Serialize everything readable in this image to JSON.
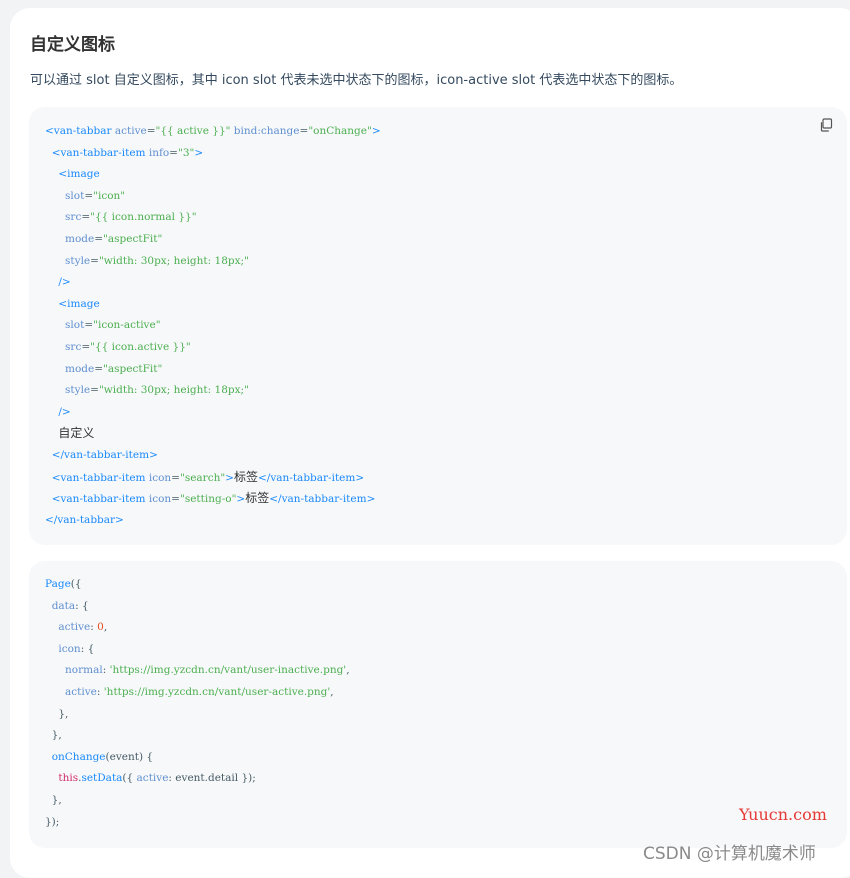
{
  "section": {
    "title": "自定义图标",
    "description": "可以通过 slot 自定义图标，其中 icon slot 代表未选中状态下的图标，icon-active slot 代表选中状态下的图标。"
  },
  "code_block_1": {
    "copy_icon": "copy-icon",
    "lines": [
      [
        {
          "t": "tag",
          "v": "<van-tabbar"
        },
        {
          "t": "attr",
          "v": " active"
        },
        {
          "t": "plain",
          "v": "="
        },
        {
          "t": "str",
          "v": "\"{{ active }}\""
        },
        {
          "t": "attr",
          "v": " bind:change"
        },
        {
          "t": "plain",
          "v": "="
        },
        {
          "t": "str",
          "v": "\"onChange\""
        },
        {
          "t": "tag",
          "v": ">"
        }
      ],
      [
        {
          "t": "plain",
          "v": "  "
        },
        {
          "t": "tag",
          "v": "<van-tabbar-item"
        },
        {
          "t": "attr",
          "v": " info"
        },
        {
          "t": "plain",
          "v": "="
        },
        {
          "t": "str",
          "v": "\"3\""
        },
        {
          "t": "tag",
          "v": ">"
        }
      ],
      [
        {
          "t": "plain",
          "v": "    "
        },
        {
          "t": "tag",
          "v": "<image"
        }
      ],
      [
        {
          "t": "plain",
          "v": "      "
        },
        {
          "t": "attr",
          "v": "slot"
        },
        {
          "t": "plain",
          "v": "="
        },
        {
          "t": "str",
          "v": "\"icon\""
        }
      ],
      [
        {
          "t": "plain",
          "v": "      "
        },
        {
          "t": "attr",
          "v": "src"
        },
        {
          "t": "plain",
          "v": "="
        },
        {
          "t": "str",
          "v": "\"{{ icon.normal }}\""
        }
      ],
      [
        {
          "t": "plain",
          "v": "      "
        },
        {
          "t": "attr",
          "v": "mode"
        },
        {
          "t": "plain",
          "v": "="
        },
        {
          "t": "str",
          "v": "\"aspectFit\""
        }
      ],
      [
        {
          "t": "plain",
          "v": "      "
        },
        {
          "t": "attr",
          "v": "style"
        },
        {
          "t": "plain",
          "v": "="
        },
        {
          "t": "str",
          "v": "\"width: 30px; height: 18px;\""
        }
      ],
      [
        {
          "t": "plain",
          "v": "    "
        },
        {
          "t": "tag",
          "v": "/>"
        }
      ],
      [
        {
          "t": "plain",
          "v": "    "
        },
        {
          "t": "tag",
          "v": "<image"
        }
      ],
      [
        {
          "t": "plain",
          "v": "      "
        },
        {
          "t": "attr",
          "v": "slot"
        },
        {
          "t": "plain",
          "v": "="
        },
        {
          "t": "str",
          "v": "\"icon-active\""
        }
      ],
      [
        {
          "t": "plain",
          "v": "      "
        },
        {
          "t": "attr",
          "v": "src"
        },
        {
          "t": "plain",
          "v": "="
        },
        {
          "t": "str",
          "v": "\"{{ icon.active }}\""
        }
      ],
      [
        {
          "t": "plain",
          "v": "      "
        },
        {
          "t": "attr",
          "v": "mode"
        },
        {
          "t": "plain",
          "v": "="
        },
        {
          "t": "str",
          "v": "\"aspectFit\""
        }
      ],
      [
        {
          "t": "plain",
          "v": "      "
        },
        {
          "t": "attr",
          "v": "style"
        },
        {
          "t": "plain",
          "v": "="
        },
        {
          "t": "str",
          "v": "\"width: 30px; height: 18px;\""
        }
      ],
      [
        {
          "t": "plain",
          "v": "    "
        },
        {
          "t": "tag",
          "v": "/>"
        }
      ],
      [
        {
          "t": "plain",
          "v": "    "
        },
        {
          "t": "txt",
          "v": "自定义"
        }
      ],
      [
        {
          "t": "plain",
          "v": "  "
        },
        {
          "t": "tag",
          "v": "</van-tabbar-item>"
        }
      ],
      [
        {
          "t": "plain",
          "v": "  "
        },
        {
          "t": "tag",
          "v": "<van-tabbar-item"
        },
        {
          "t": "attr",
          "v": " icon"
        },
        {
          "t": "plain",
          "v": "="
        },
        {
          "t": "str",
          "v": "\"search\""
        },
        {
          "t": "tag",
          "v": ">"
        },
        {
          "t": "txt",
          "v": "标签"
        },
        {
          "t": "tag",
          "v": "</van-tabbar-item>"
        }
      ],
      [
        {
          "t": "plain",
          "v": "  "
        },
        {
          "t": "tag",
          "v": "<van-tabbar-item"
        },
        {
          "t": "attr",
          "v": " icon"
        },
        {
          "t": "plain",
          "v": "="
        },
        {
          "t": "str",
          "v": "\"setting-o\""
        },
        {
          "t": "tag",
          "v": ">"
        },
        {
          "t": "txt",
          "v": "标签"
        },
        {
          "t": "tag",
          "v": "</van-tabbar-item>"
        }
      ],
      [
        {
          "t": "tag",
          "v": "</van-tabbar>"
        }
      ]
    ]
  },
  "code_block_2": {
    "lines": [
      [
        {
          "t": "fn",
          "v": "Page"
        },
        {
          "t": "plain",
          "v": "({"
        }
      ],
      [
        {
          "t": "plain",
          "v": "  "
        },
        {
          "t": "attr",
          "v": "data"
        },
        {
          "t": "plain",
          "v": ": {"
        }
      ],
      [
        {
          "t": "plain",
          "v": "    "
        },
        {
          "t": "attr",
          "v": "active"
        },
        {
          "t": "plain",
          "v": ": "
        },
        {
          "t": "num",
          "v": "0"
        },
        {
          "t": "plain",
          "v": ","
        }
      ],
      [
        {
          "t": "plain",
          "v": "    "
        },
        {
          "t": "attr",
          "v": "icon"
        },
        {
          "t": "plain",
          "v": ": {"
        }
      ],
      [
        {
          "t": "plain",
          "v": "      "
        },
        {
          "t": "attr",
          "v": "normal"
        },
        {
          "t": "plain",
          "v": ": "
        },
        {
          "t": "str",
          "v": "'https://img.yzcdn.cn/vant/user-inactive.png'"
        },
        {
          "t": "plain",
          "v": ","
        }
      ],
      [
        {
          "t": "plain",
          "v": "      "
        },
        {
          "t": "attr",
          "v": "active"
        },
        {
          "t": "plain",
          "v": ": "
        },
        {
          "t": "str",
          "v": "'https://img.yzcdn.cn/vant/user-active.png'"
        },
        {
          "t": "plain",
          "v": ","
        }
      ],
      [
        {
          "t": "plain",
          "v": "    },"
        }
      ],
      [
        {
          "t": "plain",
          "v": "  },"
        }
      ],
      [
        {
          "t": "plain",
          "v": "  "
        },
        {
          "t": "fn",
          "v": "onChange"
        },
        {
          "t": "plain",
          "v": "(event) {"
        }
      ],
      [
        {
          "t": "plain",
          "v": "    "
        },
        {
          "t": "kw",
          "v": "this"
        },
        {
          "t": "plain",
          "v": "."
        },
        {
          "t": "fn",
          "v": "setData"
        },
        {
          "t": "plain",
          "v": "({ "
        },
        {
          "t": "attr",
          "v": "active"
        },
        {
          "t": "plain",
          "v": ": event.detail });"
        }
      ],
      [
        {
          "t": "plain",
          "v": "  },"
        }
      ],
      [
        {
          "t": "plain",
          "v": "});"
        }
      ]
    ]
  },
  "watermarks": {
    "site": "Yuucn.com",
    "author": "CSDN @计算机魔术师"
  }
}
